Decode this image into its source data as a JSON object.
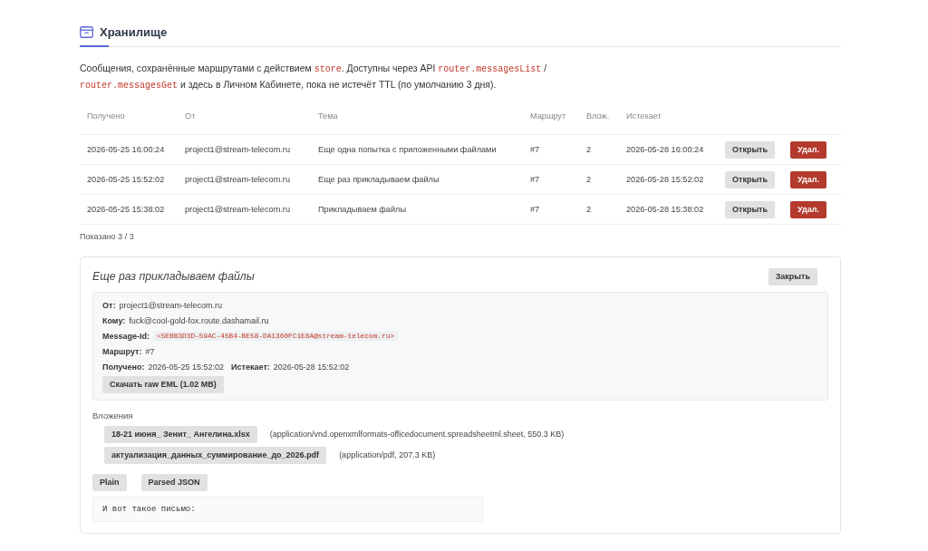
{
  "page": {
    "title": "Хранилище"
  },
  "description": [
    {
      "kind": "text",
      "text": "Сообщения, сохранённые маршрутами с действием "
    },
    {
      "kind": "code",
      "text": "store"
    },
    {
      "kind": "text",
      "text": ". Доступны через API "
    },
    {
      "kind": "code",
      "text": "router.messagesList"
    },
    {
      "kind": "text",
      "text": " / "
    },
    {
      "kind": "code",
      "text": "router.messagesGet"
    },
    {
      "kind": "text",
      "text": " и здесь в Личном Кабинете, пока не истечёт TTL (по умолчанию 3 дня)."
    }
  ],
  "table": {
    "columns": [
      "Получено",
      "От",
      "Тема",
      "Маршрут",
      "Влож.",
      "Истекает"
    ],
    "rows": [
      {
        "cells": [
          "2026-05-25 16:00:24",
          "project1@stream-telecom.ru",
          "Еще одна попытка с приложенными файлами",
          "#7",
          "2",
          "2026-05-28 16:00:24"
        ],
        "actions": [
          {
            "label": "Открыть",
            "kind": "open"
          },
          {
            "label": "Удал.",
            "kind": "delete"
          }
        ]
      },
      {
        "cells": [
          "2026-05-25 15:52:02",
          "project1@stream-telecom.ru",
          "Еще раз прикладываем файлы",
          "#7",
          "2",
          "2026-05-28 15:52:02"
        ],
        "actions": [
          {
            "label": "Открыть",
            "kind": "open"
          },
          {
            "label": "Удал.",
            "kind": "delete"
          }
        ]
      },
      {
        "cells": [
          "2026-05-25 15:38:02",
          "project1@stream-telecom.ru",
          "Прикладываем файлы",
          "#7",
          "2",
          "2026-05-28 15:38:02"
        ],
        "actions": [
          {
            "label": "Открыть",
            "kind": "open"
          },
          {
            "label": "Удал.",
            "kind": "delete"
          }
        ]
      }
    ]
  },
  "count_text": "Показано 3 / 3",
  "message": {
    "title": "Еще раз прикладываем файлы",
    "close_button": "Закрыть",
    "meta": [
      {
        "fields": [
          {
            "label": "От:",
            "value": "project1@stream-telecom.ru",
            "kind": "text"
          }
        ]
      },
      {
        "fields": [
          {
            "label": "Кому:",
            "value": "fuck@cool-gold-fox.route.dashamail.ru",
            "kind": "text"
          }
        ]
      },
      {
        "fields": [
          {
            "label": "Message-Id:",
            "value": "<5EBB3D3D-59AC-45B4-BE58-DA1360FC1E8A@stream-telecom.ru>",
            "kind": "code"
          }
        ]
      },
      {
        "fields": [
          {
            "label": "Маршрут:",
            "value": "#7",
            "kind": "text"
          }
        ]
      },
      {
        "fields": [
          {
            "label": "Получено:",
            "value": "2026-05-25 15:52:02",
            "kind": "text"
          },
          {
            "label": "Истекает:",
            "value": "2026-05-28 15:52:02",
            "kind": "text"
          }
        ]
      }
    ],
    "download_button": "Скачать raw EML (1.02 MB)",
    "attachments_label": "Вложения",
    "attachments": [
      {
        "name": "18-21 июня_ Зенит_ Ангелина.xlsx",
        "type": "(application/vnd.openxmlformats-officedocument.spreadsheetml.sheet, 550.3 KB)"
      },
      {
        "name": "актуализация_данных_суммирование_до_2026.pdf",
        "type": "(application/pdf, 207.3 KB)"
      }
    ],
    "view_buttons": [
      "Plain",
      "Parsed JSON"
    ],
    "body": "И вот такое письмо:"
  }
}
